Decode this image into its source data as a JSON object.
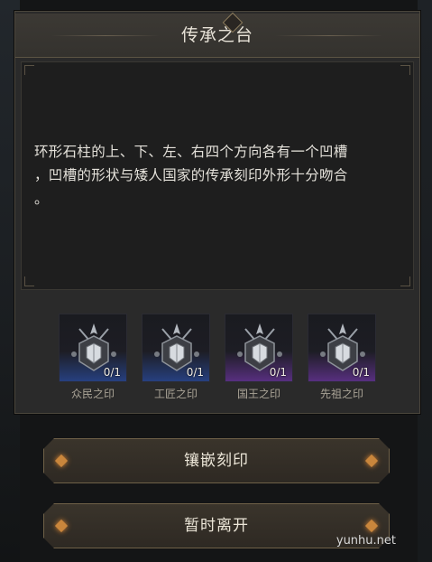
{
  "dialog": {
    "title": "传承之台",
    "description": [
      "环形石柱的上、下、左、右四个方向各有一个凹槽",
      "，凹槽的形状与矮人国家的传承刻印外形十分吻合",
      "。"
    ]
  },
  "seals": [
    {
      "name": "众民之印",
      "count": "0/1",
      "rarity_color": "#2f5fd0",
      "icon": "seal-icon"
    },
    {
      "name": "工匠之印",
      "count": "0/1",
      "rarity_color": "#2f5fd0",
      "icon": "seal-icon"
    },
    {
      "name": "国王之印",
      "count": "0/1",
      "rarity_color": "#8b3fd0",
      "icon": "seal-icon"
    },
    {
      "name": "先祖之印",
      "count": "0/1",
      "rarity_color": "#8b3fd0",
      "icon": "seal-icon"
    }
  ],
  "buttons": {
    "inlay": "镶嵌刻印",
    "leave": "暂时离开"
  },
  "watermark": "yunhu.net"
}
